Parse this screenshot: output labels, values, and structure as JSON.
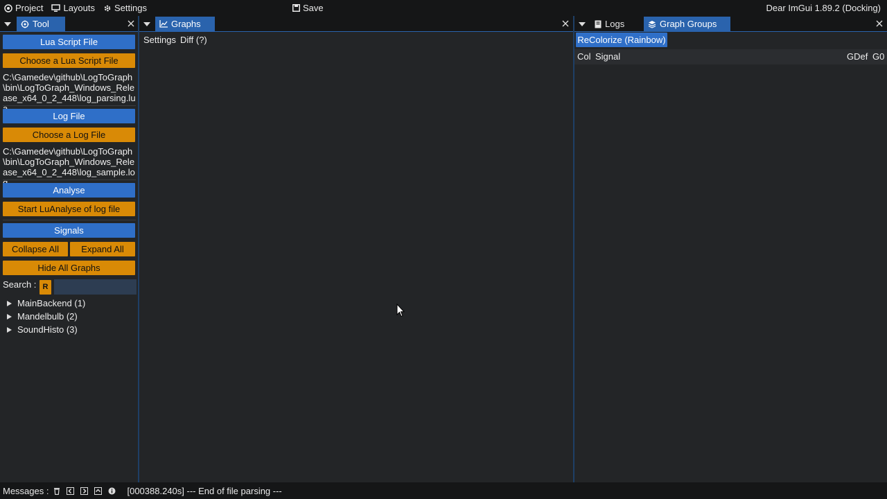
{
  "menubar": {
    "project": "Project",
    "layouts": "Layouts",
    "settings": "Settings",
    "save": "Save",
    "app_version": "Dear ImGui 1.89.2 (Docking)"
  },
  "tool_pane": {
    "tab_label": "Tool",
    "lua_section": "Lua Script File",
    "choose_lua": "Choose a Lua Script File",
    "lua_path": "C:\\Gamedev\\github\\LogToGraph\\bin\\LogToGraph_Windows_Release_x64_0_2_448\\log_parsing.lua",
    "log_section": "Log File",
    "choose_log": "Choose a Log File",
    "log_path": "C:\\Gamedev\\github\\LogToGraph\\bin\\LogToGraph_Windows_Release_x64_0_2_448\\log_sample.log",
    "analyse_section": "Analyse",
    "start_analyse": "Start LuAnalyse of log file",
    "signals_section": "Signals",
    "collapse_all": "Collapse All",
    "expand_all": "Expand All",
    "hide_all_graphs": "Hide All Graphs",
    "search_label": "Search :",
    "reset_button": "R",
    "search_value": "",
    "tree": [
      {
        "label": "MainBackend (1)"
      },
      {
        "label": "Mandelbulb (2)"
      },
      {
        "label": "SoundHisto (3)"
      }
    ]
  },
  "graphs_pane": {
    "tab_label": "Graphs",
    "menu_settings": "Settings",
    "menu_diff": "Diff (?)"
  },
  "right_pane": {
    "tab_logs": "Logs",
    "tab_graph_groups": "Graph Groups",
    "recolorize": "ReColorize (Rainbow)",
    "columns": {
      "col": "Col",
      "signal": "Signal",
      "gdef": "GDef",
      "g0": "G0"
    }
  },
  "statusbar": {
    "label": "Messages :",
    "message": "[000388.240s] --- End of file parsing ---"
  },
  "colors": {
    "accent_blue": "#2f6fc8",
    "accent_orange": "#d98a06",
    "tab_active": "#2a63ad",
    "background": "#232527",
    "bar": "#151617"
  }
}
